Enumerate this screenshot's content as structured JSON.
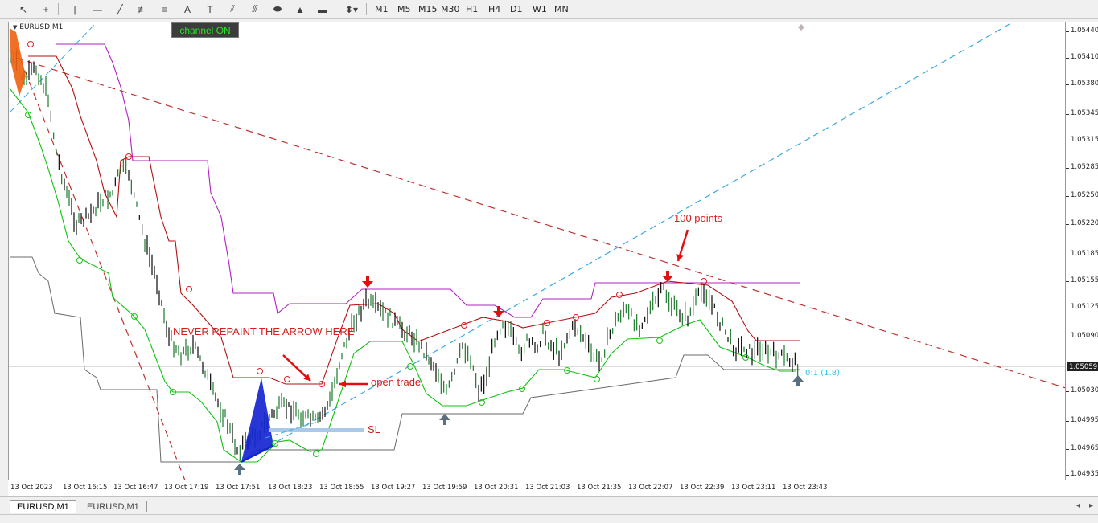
{
  "toolbar": {
    "tools": [
      {
        "name": "cursor-icon",
        "glyph": "↖"
      },
      {
        "name": "crosshair-icon",
        "glyph": "+"
      },
      {
        "name": "vertical-line-icon",
        "glyph": "|"
      },
      {
        "name": "horizontal-line-icon",
        "glyph": "—"
      },
      {
        "name": "trendline-icon",
        "glyph": "╱"
      },
      {
        "name": "fibonacci-fan-icon",
        "glyph": "≢"
      },
      {
        "name": "fibonacci-icon",
        "glyph": "≡"
      },
      {
        "name": "text-icon",
        "glyph": "A"
      },
      {
        "name": "text-label-icon",
        "glyph": "T"
      },
      {
        "name": "channel-icon",
        "glyph": "⫽"
      },
      {
        "name": "gann-icon",
        "glyph": "⫻"
      },
      {
        "name": "ellipse-icon",
        "glyph": "⬬"
      },
      {
        "name": "triangle-icon",
        "glyph": "▲"
      },
      {
        "name": "rectangle-icon",
        "glyph": "▬"
      },
      {
        "name": "arrows-dropdown-icon",
        "glyph": "⬍▾"
      }
    ],
    "timeframes": [
      "M1",
      "M5",
      "M15",
      "M30",
      "H1",
      "H4",
      "D1",
      "W1",
      "MN"
    ]
  },
  "chart": {
    "symbol": "EURUSD,M1",
    "channel_button": "channel ON",
    "annotations": {
      "never_repaint": "NEVER REPAINT THE ARROW HERE",
      "open_trade": "open trade",
      "sl": "SL",
      "points": "100 points",
      "ratio": "0:1 (1.8)"
    },
    "current_price": "1.05059",
    "price_axis": [
      "1.05440",
      "1.05410",
      "1.05380",
      "1.05345",
      "1.05315",
      "1.05285",
      "1.05250",
      "1.05220",
      "1.05185",
      "1.05155",
      "1.05125",
      "1.05090",
      "1.05030",
      "1.04995",
      "1.04965",
      "1.04935"
    ],
    "time_axis": [
      "13 Oct 2023",
      "13 Oct 16:15",
      "13 Oct 16:47",
      "13 Oct 17:19",
      "13 Oct 17:51",
      "13 Oct 18:23",
      "13 Oct 18:55",
      "13 Oct 19:27",
      "13 Oct 19:59",
      "13 Oct 20:31",
      "13 Oct 21:03",
      "13 Oct 21:35",
      "13 Oct 22:07",
      "13 Oct 22:39",
      "13 Oct 23:11",
      "13 Oct 23:43"
    ],
    "colors": {
      "upper_band": "#b01010",
      "lower_band": "#10c010",
      "outer_upper": "#b020c0",
      "outer_lower": "#6a6a6a",
      "candles": "#0a0a0a",
      "sell_arrow": "#e01010",
      "buy_arrow": "#5a7080",
      "trend_down": "#c03030",
      "trend_up": "#3aa8e0",
      "sl_bar": "#aac8e8"
    }
  },
  "tabs": [
    "EURUSD,M1",
    "EURUSD,M1"
  ]
}
